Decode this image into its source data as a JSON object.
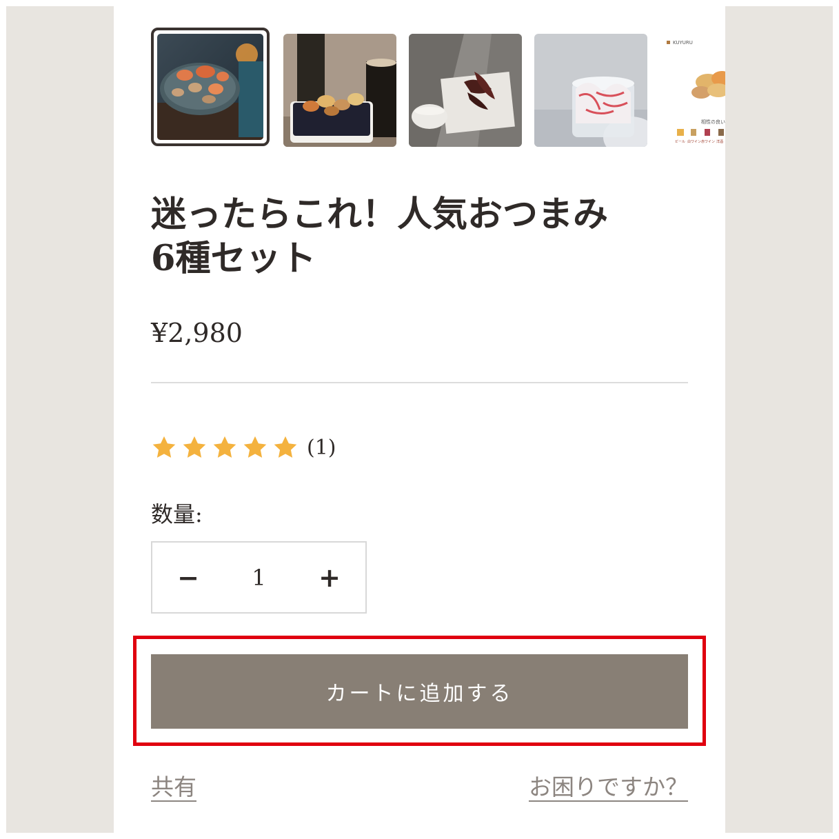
{
  "gallery": {
    "thumbnails": [
      {
        "label": "product-photo-1",
        "active": true
      },
      {
        "label": "product-photo-2",
        "active": false
      },
      {
        "label": "product-photo-3",
        "active": false
      },
      {
        "label": "product-photo-4",
        "active": false
      },
      {
        "label": "product-photo-5",
        "active": false
      }
    ],
    "thumb5_brand": "KUYURU",
    "thumb5_caption": "相性の良いお",
    "thumb5_drinks": [
      "ビール",
      "白ワイン",
      "赤ワイン",
      "洋酒"
    ]
  },
  "product": {
    "title_line1": "迷ったらこれ！人気おつまみ",
    "title_line2": "6種セット",
    "price": "¥2,980"
  },
  "rating": {
    "stars": 5,
    "max": 5,
    "count_text": "(1)",
    "star_color": "#f4b23e"
  },
  "quantity": {
    "label": "数量:",
    "value": "1",
    "minus": "−",
    "plus": "+"
  },
  "actions": {
    "add_to_cart": "カートに追加する",
    "share": "共有",
    "help": "お困りですか？"
  },
  "colors": {
    "cart_button": "#887f75",
    "highlight": "#e0000f",
    "side_panel": "#e8e5e0"
  }
}
